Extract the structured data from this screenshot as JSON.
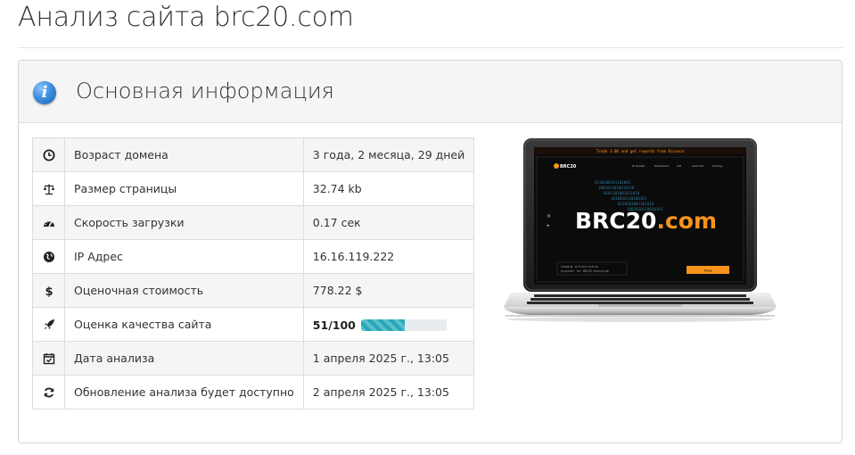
{
  "page": {
    "title": "Анализ сайта brc20.com"
  },
  "panel": {
    "title": "Основная информация",
    "icon": "info-icon"
  },
  "rows": [
    {
      "icon": "clock-icon",
      "label": "Возраст домена",
      "value": "3 года, 2 месяца, 29 дней"
    },
    {
      "icon": "scale-icon",
      "label": "Размер страницы",
      "value": "32.74 kb"
    },
    {
      "icon": "speedometer-icon",
      "label": "Скорость загрузки",
      "value": "0.17 сек"
    },
    {
      "icon": "globe-icon",
      "label": "IP Адрес",
      "value": "16.16.119.222"
    },
    {
      "icon": "dollar-icon",
      "label": "Оценочная стоимость",
      "value": "778.22 $"
    },
    {
      "icon": "rocket-icon",
      "label": "Оценка качества сайта",
      "value": "51/100",
      "progress": 0.51
    },
    {
      "icon": "calendar-check-icon",
      "label": "Дата анализа",
      "value": "1 апреля 2025 г., 13:05"
    },
    {
      "icon": "refresh-icon",
      "label": "Обновление анализа будет доступно",
      "value": "2 апреля 2025 г., 13:05"
    }
  ],
  "screenshot": {
    "banner": "Trade 3.0K and get rewards from Binance",
    "logo_small": "BRC20",
    "nav": [
      "IP Toolset",
      "Dashboard",
      "AIO",
      "Launcher",
      "Trading"
    ],
    "brand_main": "BRC20",
    "brand_suffix": ".com",
    "caption_line1": "Leading infrastructure",
    "caption_line2": "provider for BRC20 ecosystem",
    "button": "Trade",
    "colors": {
      "accent": "#f7931a",
      "screen_bg": "#0b0b0c",
      "matrix": "#3aa0c8"
    }
  },
  "colors": {
    "progress": "#26a9b8",
    "row_alt": "#f5f5f5",
    "border": "#dddddd"
  }
}
